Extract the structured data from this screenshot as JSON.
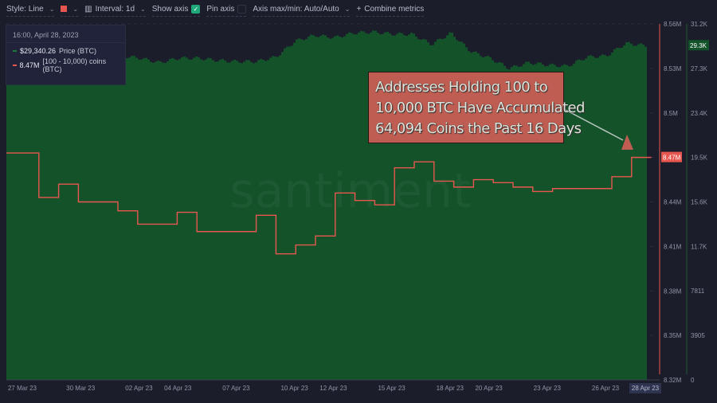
{
  "toolbar": {
    "style_label": "Style: Line",
    "interval_label": "Interval: 1d",
    "show_axis_label": "Show axis",
    "pin_axis_label": "Pin axis",
    "axis_maxmin_label": "Axis max/min: Auto/Auto",
    "combine_label": "Combine metrics",
    "metric_color": "#e8574f"
  },
  "legend": {
    "date": "16:00, April 28, 2023",
    "items": [
      {
        "value": "$29,340.26",
        "label": "Price (BTC)",
        "color": "#1f7a3a"
      },
      {
        "value": "8.47M",
        "label": "[100 - 10,000) coins (BTC)",
        "color": "#e8574f"
      }
    ]
  },
  "annotation": {
    "lines": [
      "Addresses Holding 100 to",
      "10,000 BTC Have Accumulated",
      "64,094 Coins the Past 16 Days"
    ]
  },
  "chart_data": {
    "type": "line",
    "title": "",
    "x": [
      "27 Mar",
      "28 Mar",
      "29 Mar",
      "30 Mar",
      "31 Mar",
      "01 Apr",
      "02 Apr",
      "03 Apr",
      "04 Apr",
      "05 Apr",
      "06 Apr",
      "07 Apr",
      "08 Apr",
      "09 Apr",
      "10 Apr",
      "11 Apr",
      "12 Apr",
      "13 Apr",
      "14 Apr",
      "15 Apr",
      "16 Apr",
      "17 Apr",
      "18 Apr",
      "19 Apr",
      "20 Apr",
      "21 Apr",
      "22 Apr",
      "23 Apr",
      "24 Apr",
      "25 Apr",
      "26 Apr",
      "27 Apr",
      "28 Apr"
    ],
    "x_tick_labels": [
      "27 Mar 23",
      "30 Mar 23",
      "02 Apr 23",
      "04 Apr 23",
      "07 Apr 23",
      "10 Apr 23",
      "12 Apr 23",
      "15 Apr 23",
      "18 Apr 23",
      "20 Apr 23",
      "23 Apr 23",
      "26 Apr 23"
    ],
    "x_tick_index": [
      0,
      3,
      6,
      8,
      11,
      14,
      16,
      19,
      22,
      24,
      27,
      30
    ],
    "x_cursor_label": "28 Apr 23",
    "series": [
      {
        "name": "[100 - 10,000) coins (BTC)",
        "axis": "left",
        "style": "step-line",
        "color": "#e8574f",
        "values": [
          8.473,
          8.443,
          8.452,
          8.44,
          8.44,
          8.434,
          8.425,
          8.425,
          8.433,
          8.42,
          8.42,
          8.42,
          8.431,
          8.405,
          8.411,
          8.417,
          8.446,
          8.441,
          8.438,
          8.463,
          8.467,
          8.454,
          8.45,
          8.455,
          8.453,
          8.45,
          8.447,
          8.449,
          8.449,
          8.449,
          8.457,
          8.47,
          8.47
        ]
      },
      {
        "name": "Price (BTC)",
        "axis": "right",
        "style": "area",
        "color": "#1f6b34",
        "unit": "K USD",
        "values": [
          27.2,
          27.3,
          28.3,
          28.0,
          28.5,
          28.4,
          28.2,
          27.8,
          28.2,
          28.2,
          28.0,
          27.9,
          27.9,
          28.3,
          29.7,
          30.2,
          30.0,
          30.4,
          30.5,
          30.3,
          30.3,
          29.4,
          30.4,
          28.8,
          28.2,
          27.3,
          27.8,
          27.6,
          27.5,
          28.3,
          28.4,
          29.5,
          29.3
        ]
      }
    ],
    "y_left": {
      "ticks": [
        "8.56M",
        "8.53M",
        "8.5M",
        "8.47M",
        "8.44M",
        "8.41M",
        "8.38M",
        "8.35M",
        "8.32M"
      ],
      "tick_values": [
        8.56,
        8.53,
        8.5,
        8.47,
        8.44,
        8.41,
        8.38,
        8.35,
        8.32
      ],
      "ylim": [
        8.32,
        8.56
      ],
      "current_label": "8.47M"
    },
    "y_right": {
      "ticks": [
        "31.2K",
        "27.3K",
        "23.4K",
        "19.5K",
        "15.6K",
        "11.7K",
        "7811",
        "3905",
        "0"
      ],
      "tick_values": [
        31.2,
        27.3,
        23.4,
        19.5,
        15.6,
        11.7,
        7.811,
        3.905,
        0
      ],
      "ylim": [
        0,
        31.2
      ],
      "current_label": "29.3K"
    },
    "watermark": "santiment",
    "grid": true
  }
}
